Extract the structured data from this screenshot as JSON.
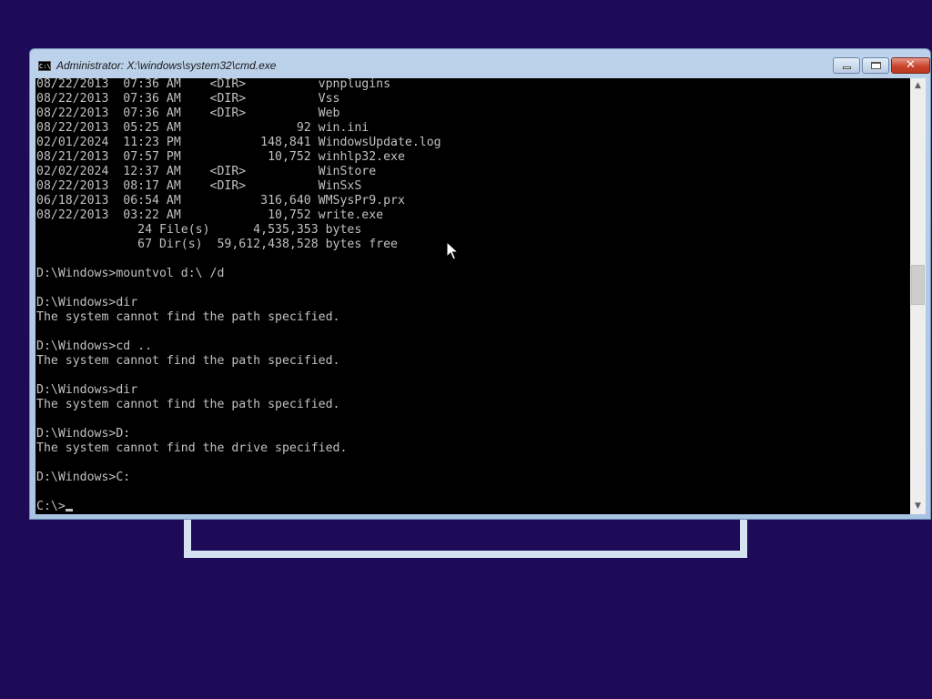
{
  "window": {
    "title": "Administrator: X:\\windows\\system32\\cmd.exe",
    "icon": "cmd-icon",
    "icon_text": "C:\\",
    "buttons": [
      "minimize-icon",
      "maximize-icon",
      "close-icon"
    ],
    "close_glyph": "✕"
  },
  "console": {
    "lines": [
      "08/22/2013  07:36 AM    <DIR>          vpnplugins",
      "08/22/2013  07:36 AM    <DIR>          Vss",
      "08/22/2013  07:36 AM    <DIR>          Web",
      "08/22/2013  05:25 AM                92 win.ini",
      "02/01/2024  11:23 PM           148,841 WindowsUpdate.log",
      "08/21/2013  07:57 PM            10,752 winhlp32.exe",
      "02/02/2024  12:37 AM    <DIR>          WinStore",
      "08/22/2013  08:17 AM    <DIR>          WinSxS",
      "06/18/2013  06:54 AM           316,640 WMSysPr9.prx",
      "08/22/2013  03:22 AM            10,752 write.exe",
      "              24 File(s)      4,535,353 bytes",
      "              67 Dir(s)  59,612,438,528 bytes free",
      "",
      "D:\\Windows>mountvol d:\\ /d",
      "",
      "D:\\Windows>dir",
      "The system cannot find the path specified.",
      "",
      "D:\\Windows>cd ..",
      "The system cannot find the path specified.",
      "",
      "D:\\Windows>dir",
      "The system cannot find the path specified.",
      "",
      "D:\\Windows>D:",
      "The system cannot find the drive specified.",
      "",
      "D:\\Windows>C:",
      ""
    ],
    "prompt": "C:\\>",
    "text_color": "#c0c0c0",
    "background_color": "#000000"
  },
  "scrollbar": {
    "up_glyph": "▲",
    "down_glyph": "▼",
    "position_fraction": 0.47
  },
  "desktop": {
    "background_color": "#1f0a57"
  }
}
